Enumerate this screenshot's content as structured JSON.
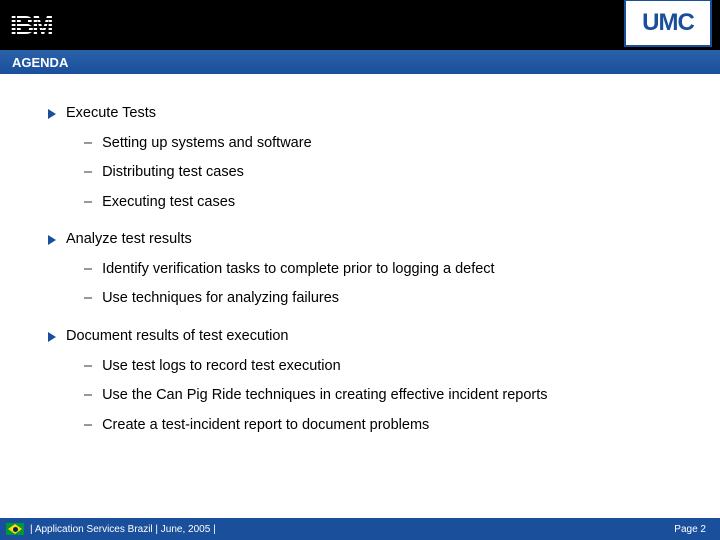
{
  "header": {
    "left_logo_label": "IBM",
    "right_badge_label": "UMC"
  },
  "title": "AGENDA",
  "sections": [
    {
      "heading": "Execute Tests",
      "items": [
        "Setting up systems and software",
        "Distributing test cases",
        "Executing test cases"
      ]
    },
    {
      "heading": "Analyze test results",
      "items": [
        "Identify verification tasks to complete prior to logging a defect",
        "Use techniques for analyzing failures"
      ]
    },
    {
      "heading": "Document results of test execution",
      "items": [
        "Use test logs to record test execution",
        "Use the Can Pig Ride techniques in creating effective incident reports",
        "Create a test-incident report to document problems"
      ]
    }
  ],
  "footer": {
    "left": "|  Application Services Brazil  |  June, 2005  |",
    "right": "Page 2"
  }
}
